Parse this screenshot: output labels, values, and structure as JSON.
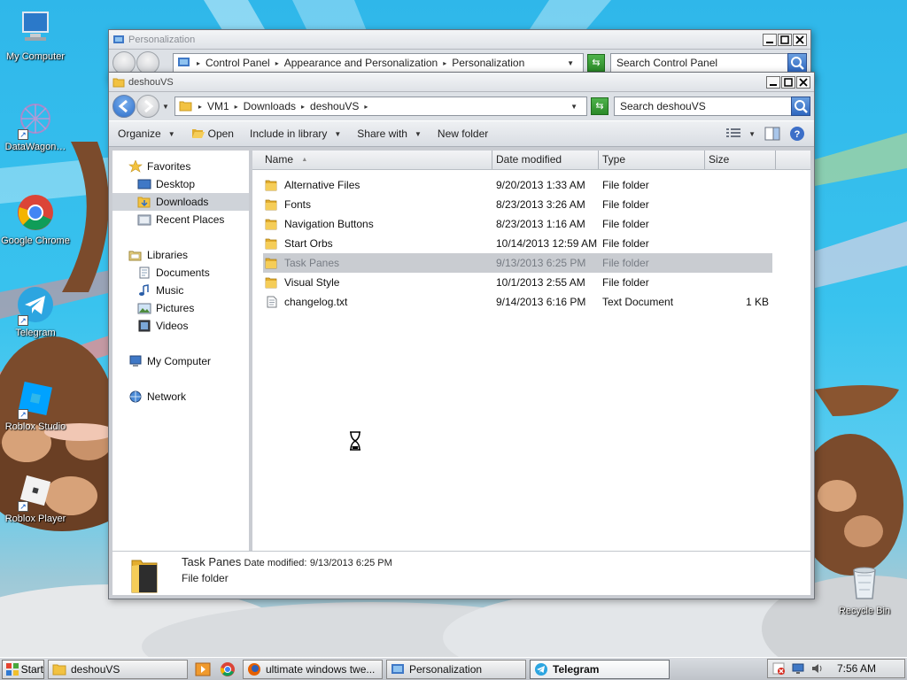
{
  "colors": {
    "desktop_bg": "#2fb7ea",
    "folder_yellow": "#f2c241",
    "selection_gray": "#c9ccd1",
    "accent_blue": "#2a6bc8"
  },
  "desktop": {
    "icons": [
      {
        "label": "My Computer",
        "icon": "computer-icon",
        "shortcut": false
      },
      {
        "label": "DataWagon…",
        "icon": "datawagon-icon",
        "shortcut": true
      },
      {
        "label": "Google Chrome",
        "icon": "chrome-icon",
        "shortcut": false
      },
      {
        "label": "Telegram",
        "icon": "telegram-icon",
        "shortcut": true
      },
      {
        "label": "Roblox Studio",
        "icon": "roblox-studio-icon",
        "shortcut": true
      },
      {
        "label": "Roblox Player",
        "icon": "roblox-player-icon",
        "shortcut": true
      },
      {
        "label": "Recycle Bin",
        "icon": "recycle-bin-icon",
        "shortcut": false
      }
    ]
  },
  "personalization_window": {
    "title": "Personalization",
    "breadcrumb": [
      "Control Panel",
      "Appearance and Personalization",
      "Personalization"
    ],
    "search_placeholder": "Search Control Panel"
  },
  "explorer": {
    "title": "deshouVS",
    "breadcrumb": [
      "VM1",
      "Downloads",
      "deshouVS"
    ],
    "search_placeholder": "Search deshouVS",
    "toolbar": {
      "organize": "Organize",
      "open": "Open",
      "include": "Include in library",
      "share": "Share with",
      "new_folder": "New folder"
    },
    "nav": {
      "favorites": "Favorites",
      "desktop": "Desktop",
      "downloads": "Downloads",
      "recent": "Recent Places",
      "libraries": "Libraries",
      "documents": "Documents",
      "music": "Music",
      "pictures": "Pictures",
      "videos": "Videos",
      "my_computer": "My Computer",
      "network": "Network"
    },
    "columns": {
      "name": "Name",
      "date": "Date modified",
      "type": "Type",
      "size": "Size"
    },
    "files": [
      {
        "name": "Alternative Files",
        "date": "9/20/2013 1:33 AM",
        "type": "File folder",
        "size": "",
        "kind": "folder"
      },
      {
        "name": "Fonts",
        "date": "8/23/2013 3:26 AM",
        "type": "File folder",
        "size": "",
        "kind": "folder"
      },
      {
        "name": "Navigation Buttons",
        "date": "8/23/2013 1:16 AM",
        "type": "File folder",
        "size": "",
        "kind": "folder"
      },
      {
        "name": "Start Orbs",
        "date": "10/14/2013 12:59 AM",
        "type": "File folder",
        "size": "",
        "kind": "folder"
      },
      {
        "name": "Task Panes",
        "date": "9/13/2013 6:25 PM",
        "type": "File folder",
        "size": "",
        "kind": "folder",
        "selected": true
      },
      {
        "name": "Visual Style",
        "date": "10/1/2013 2:55 AM",
        "type": "File folder",
        "size": "",
        "kind": "folder"
      },
      {
        "name": "changelog.txt",
        "date": "9/14/2013 6:16 PM",
        "type": "Text Document",
        "size": "1 KB",
        "kind": "text"
      }
    ],
    "details": {
      "name": "Task Panes",
      "date_label": "Date modified:",
      "date": "9/13/2013 6:25 PM",
      "type": "File folder"
    }
  },
  "taskbar": {
    "start": "Start",
    "buttons": [
      {
        "label": "deshouVS",
        "icon": "folder-icon"
      },
      {
        "label": "ultimate windows twe...",
        "icon": "firefox-icon"
      },
      {
        "label": "Personalization",
        "icon": "control-panel-icon"
      },
      {
        "label": "Telegram",
        "icon": "telegram-icon"
      }
    ],
    "clock": "7:56 AM"
  }
}
